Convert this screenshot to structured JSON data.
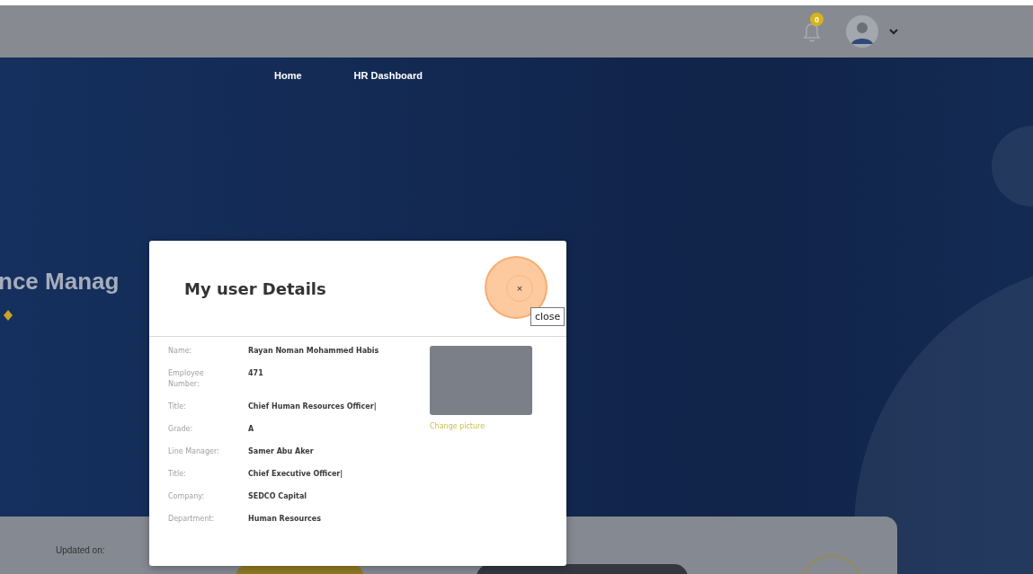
{
  "header": {
    "notification_count": "0"
  },
  "nav": [
    {
      "label": "Home"
    },
    {
      "label": "HR Dashboard"
    }
  ],
  "page": {
    "heading": "nce Manag",
    "updated_label": "Updated on:"
  },
  "dialog": {
    "title": "My user Details",
    "close_button": "×",
    "tooltip": "close",
    "fields": [
      {
        "label": "Name:",
        "value": "Rayan Noman Mohammed Habis"
      },
      {
        "label": "Employee Number:",
        "value": "471"
      },
      {
        "label": "Title:",
        "value": "Chief Human Resources Officer|"
      },
      {
        "label": "Grade:",
        "value": "A"
      },
      {
        "label": "Line Manager:",
        "value": "Samer Abu Aker"
      },
      {
        "label": "Title:",
        "value": "Chief Executive Officer|"
      },
      {
        "label": "Company:",
        "value": "SEDCO Capital"
      },
      {
        "label": "Department:",
        "value": "Human Resources"
      }
    ],
    "change_picture": "Change picture"
  }
}
